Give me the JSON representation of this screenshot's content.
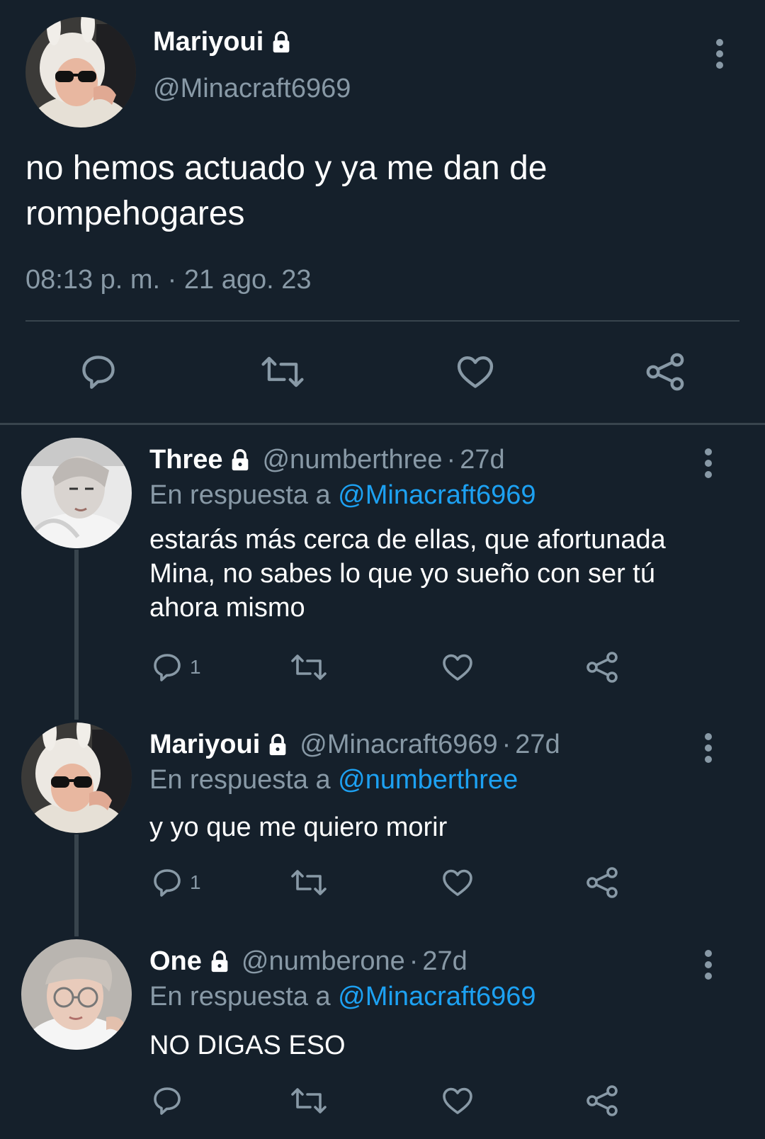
{
  "main_tweet": {
    "name": "Mariyoui",
    "handle": "@Minacraft6969",
    "text": "no hemos actuado y ya me dan de rompehogares",
    "timestamp": "08:13 p. m. · 21 ago. 23",
    "icons": {
      "lock": "lock-icon",
      "more": "more-vertical-icon",
      "reply": "reply-icon",
      "retweet": "retweet-icon",
      "like": "heart-icon",
      "share": "share-icon"
    }
  },
  "replies": [
    {
      "name": "Three",
      "handle": "@numberthree",
      "time": "27d",
      "in_reply_prefix": "En respuesta a",
      "in_reply_to": "@Minacraft6969",
      "text": "estarás más cerca de ellas, que afortunada Mina, no sabes lo que yo sueño con ser tú ahora mismo",
      "reply_count": "1"
    },
    {
      "name": "Mariyoui",
      "handle": "@Minacraft6969",
      "time": "27d",
      "in_reply_prefix": "En respuesta a",
      "in_reply_to": "@numberthree",
      "text": "y yo que me quiero morir",
      "reply_count": "1"
    },
    {
      "name": "One",
      "handle": "@numberone",
      "time": "27d",
      "in_reply_prefix": "En respuesta a",
      "in_reply_to": "@Minacraft6969",
      "text": "NO DIGAS ESO",
      "reply_count": ""
    }
  ],
  "colors": {
    "background": "#15202b",
    "secondary_text": "#8899a6",
    "accent": "#1da1f2",
    "divider": "#38444d"
  }
}
